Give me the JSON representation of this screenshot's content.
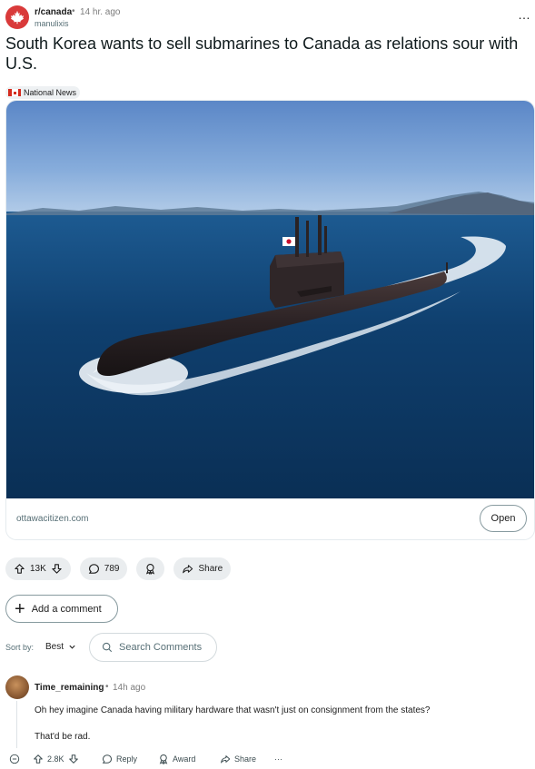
{
  "post": {
    "subreddit": "r/canada",
    "separator": "•",
    "time": "14 hr. ago",
    "author": "manulixis",
    "more_glyph": "…",
    "title": "South Korea wants to sell submarines to Canada as relations sour with U.S.",
    "flair": "National News",
    "link_domain": "ottawacitizen.com",
    "open_label": "Open"
  },
  "actions": {
    "votes": "13K",
    "comments": "789",
    "share": "Share"
  },
  "add_comment_label": "Add a comment",
  "sort": {
    "label": "Sort by:",
    "value": "Best",
    "search_placeholder": "Search Comments"
  },
  "comment": {
    "user": "Time_remaining",
    "separator": "•",
    "time": "14h ago",
    "body": [
      "Oh hey imagine Canada having military hardware that wasn't just on consignment from the states?",
      "That'd be rad."
    ],
    "votes": "2.8K",
    "reply": "Reply",
    "award": "Award",
    "share": "Share",
    "more_glyph": "···"
  },
  "colors": {
    "subreddit_avatar": "#d93a3a",
    "pill_bg": "#eaedef",
    "sea": "#0f3f6b",
    "sky": "#8eb4de"
  },
  "icons": [
    "maple-leaf-icon",
    "more-icon",
    "upvote-icon",
    "downvote-icon",
    "comment-icon",
    "award-icon",
    "share-icon",
    "plus-icon",
    "search-icon",
    "chevron-down-icon",
    "collapse-icon"
  ]
}
